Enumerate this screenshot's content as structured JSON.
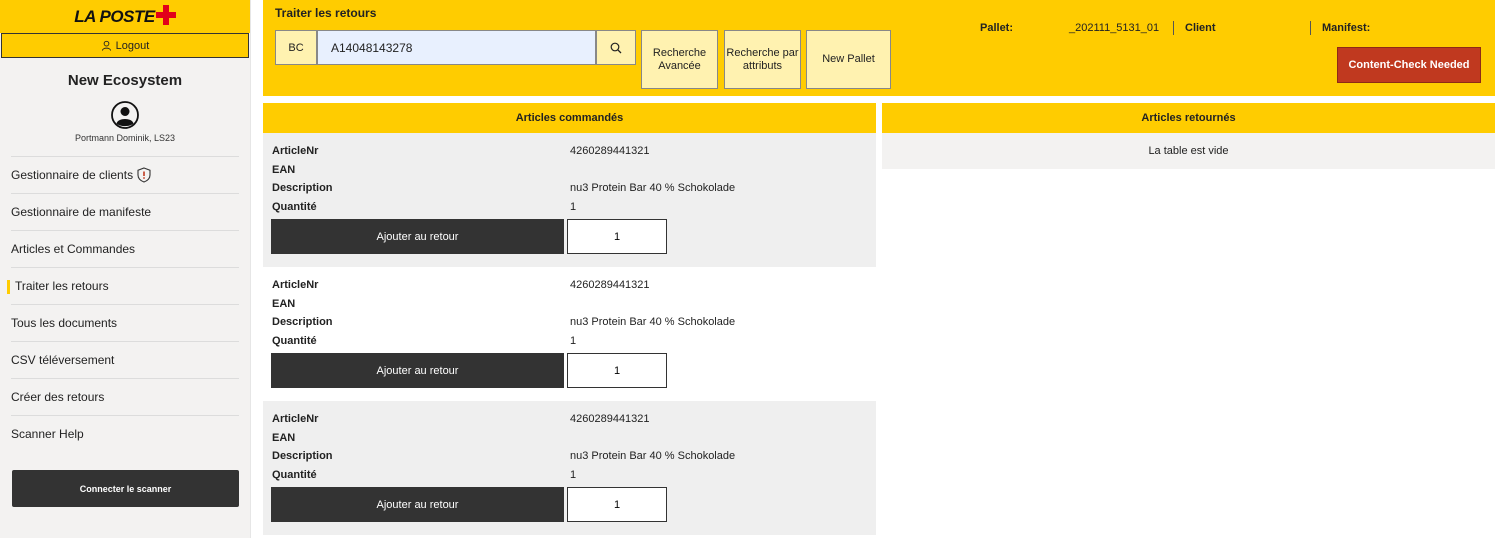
{
  "brand": {
    "logo_text": "LA POSTE"
  },
  "sidebar": {
    "logout_label": "Logout",
    "eco_title": "New Ecosystem",
    "user_name": "Portmann Dominik, LS23",
    "items": [
      {
        "label": "Gestionnaire de clients"
      },
      {
        "label": "Gestionnaire de manifeste"
      },
      {
        "label": "Articles et Commandes"
      },
      {
        "label": "Traiter les retours"
      },
      {
        "label": "Tous les documents"
      },
      {
        "label": "CSV téléversement"
      },
      {
        "label": "Créer des retours"
      },
      {
        "label": "Scanner Help"
      }
    ],
    "active_index": 3,
    "scanner_label": "Connecter le scanner"
  },
  "topbar": {
    "title": "Traiter les retours",
    "bc_label": "BC",
    "search_value": "A14048143278",
    "btn_advanced": "Recherche Avancée",
    "btn_attributes": "Recherche par attributs",
    "btn_new_pallet": "New Pallet",
    "pallet_label": "Pallet:",
    "pallet_value": "_202111_5131_01",
    "client_label": "Client",
    "manifest_label": "Manifest:",
    "content_check_label": "Content-Check Needed"
  },
  "ordered": {
    "title": "Articles commandés",
    "field_labels": {
      "article": "ArticleNr",
      "ean": "EAN",
      "description": "Description",
      "quantity": "Quantité"
    },
    "add_label": "Ajouter au retour",
    "items": [
      {
        "article": "4260289441321",
        "ean": "",
        "description": "nu3 Protein Bar 40 % Schokolade",
        "quantity": "1",
        "qty_input": "1"
      },
      {
        "article": "4260289441321",
        "ean": "",
        "description": "nu3 Protein Bar 40 % Schokolade",
        "quantity": "1",
        "qty_input": "1"
      },
      {
        "article": "4260289441321",
        "ean": "",
        "description": "nu3 Protein Bar 40 % Schokolade",
        "quantity": "1",
        "qty_input": "1"
      }
    ]
  },
  "returned": {
    "title": "Articles retournés",
    "empty_text": "La table est vide"
  },
  "colors": {
    "accent": "#ffcc00",
    "danger": "#c0391f",
    "dark": "#333333",
    "logo_red": "#e2001a"
  }
}
